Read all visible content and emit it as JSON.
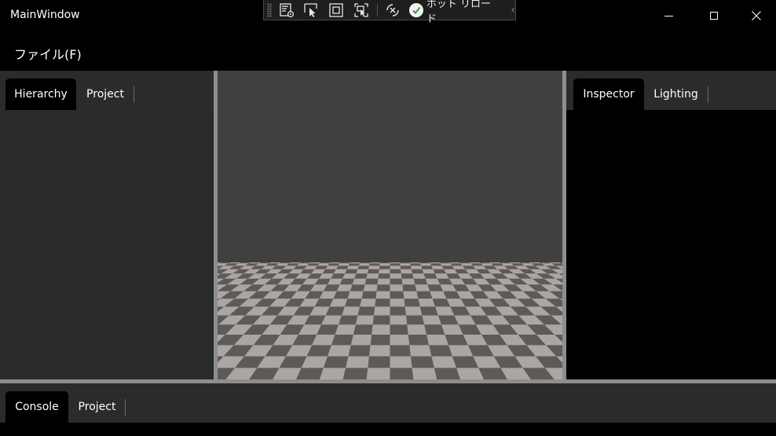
{
  "window": {
    "title": "MainWindow"
  },
  "devbar": {
    "hot_reload_label": "ホット リロード",
    "icons": [
      "live-visual-tree-icon",
      "select-element-icon",
      "display-layout-adorners-icon",
      "track-focus-icon",
      "xaml-binding-failures-icon"
    ]
  },
  "menu": {
    "file_label": "ファイル(F)"
  },
  "left_panel": {
    "tabs": [
      {
        "label": "Hierarchy",
        "active": true
      },
      {
        "label": "Project",
        "active": false
      }
    ]
  },
  "right_panel": {
    "tabs": [
      {
        "label": "Inspector",
        "active": true
      },
      {
        "label": "Lighting",
        "active": false
      }
    ]
  },
  "bottom_panel": {
    "tabs": [
      {
        "label": "Console",
        "active": true
      },
      {
        "label": "Project",
        "active": false
      }
    ]
  },
  "colors": {
    "background": "#000000",
    "panel": "#2b2b2b",
    "viewport_sky": "#404040",
    "splitter": "#8e8e8e",
    "floor_light": "#aca6a2",
    "floor_dark": "#5e5a58"
  }
}
